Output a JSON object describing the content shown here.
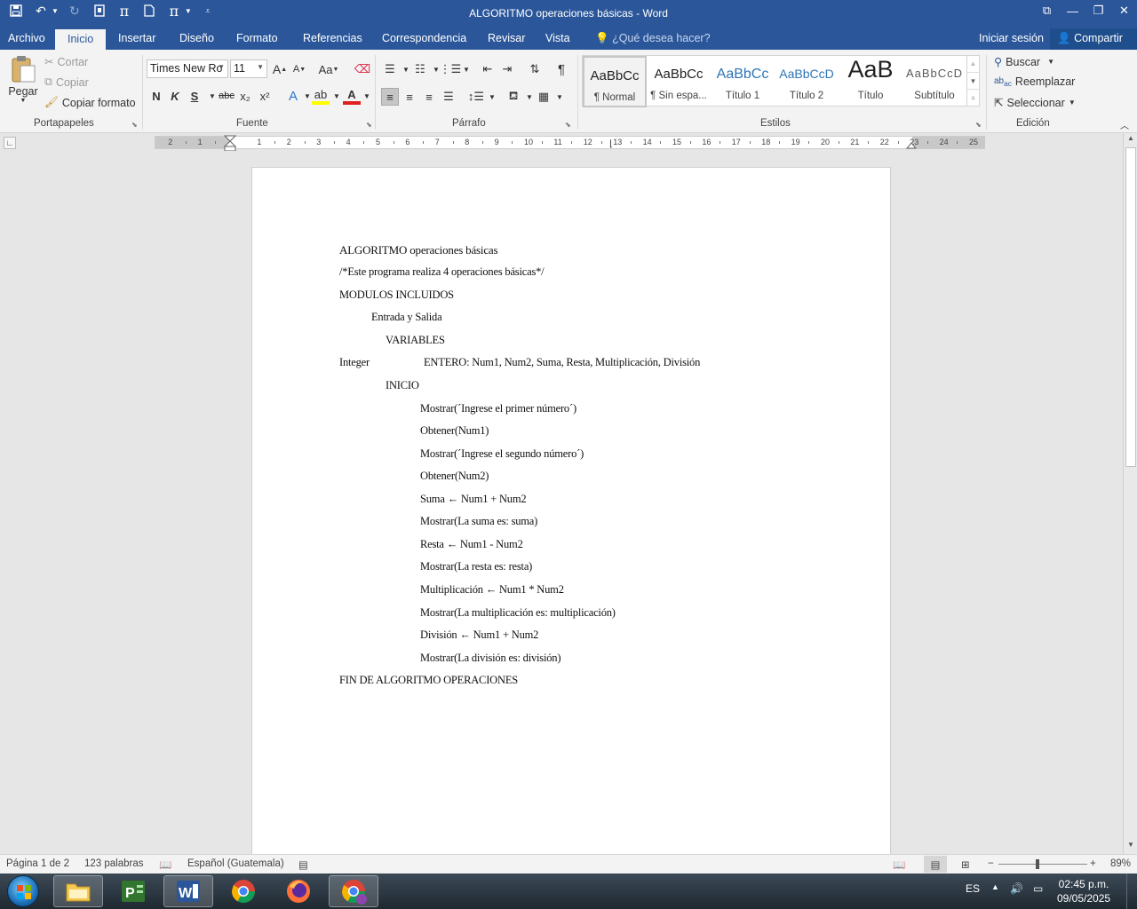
{
  "window": {
    "title": "ALGORITMO operaciones básicas - Word"
  },
  "tabs": {
    "archivo": "Archivo",
    "inicio": "Inicio",
    "insertar": "Insertar",
    "diseno": "Diseño",
    "formato": "Formato",
    "referencias": "Referencias",
    "correspondencia": "Correspondencia",
    "revisar": "Revisar",
    "vista": "Vista",
    "tellme": "¿Qué desea hacer?",
    "signin": "Iniciar sesión",
    "share": "Compartir"
  },
  "ribbon": {
    "clipboard": {
      "paste": "Pegar",
      "cut": "Cortar",
      "copy": "Copiar",
      "format_painter": "Copiar formato",
      "label": "Portapapeles"
    },
    "font": {
      "name": "Times New Ro",
      "size": "11",
      "label": "Fuente",
      "bold": "N",
      "italic": "K",
      "underline": "S",
      "strike": "abc",
      "subscript": "x₂",
      "superscript": "x²",
      "grow": "A",
      "shrink": "A",
      "case": "Aa",
      "effects": "A",
      "highlight": "ab",
      "color": "A"
    },
    "paragraph": {
      "label": "Párrafo"
    },
    "styles": {
      "label": "Estilos",
      "items": [
        {
          "sample": "AaBbCc",
          "name": "¶ Normal"
        },
        {
          "sample": "AaBbCc",
          "name": "¶ Sin espa..."
        },
        {
          "sample": "AaBbCc",
          "name": "Título 1"
        },
        {
          "sample": "AaBbCcD",
          "name": "Título 2"
        },
        {
          "sample": "AaB",
          "name": "Título"
        },
        {
          "sample": "AaBbCcD",
          "name": "Subtítulo"
        }
      ]
    },
    "editing": {
      "label": "Edición",
      "find": "Buscar",
      "replace": "Reemplazar",
      "select": "Seleccionar"
    }
  },
  "ruler": {
    "numbers": [
      "2",
      "1",
      "1",
      "2",
      "3",
      "4",
      "5",
      "6",
      "7",
      "8",
      "9",
      "10",
      "11",
      "12",
      "13",
      "14",
      "15",
      "16",
      "17",
      "18",
      "19",
      "20",
      "21",
      "22",
      "23",
      "24",
      "25"
    ]
  },
  "document": {
    "lines": [
      "ALGORITMO operaciones básicas",
      "/*Este programa realiza 4 operaciones básicas*/",
      "MODULOS INCLUIDOS",
      "Entrada y Salida",
      "VARIABLES",
      "Integer",
      "ENTERO: Num1, Num2, Suma, Resta, Multiplicación, División",
      "INICIO",
      "Mostrar(´Ingrese el primer número´)",
      "Obtener(Num1)",
      "Mostrar(´Ingrese el segundo número´)",
      "Obtener(Num2)",
      "Suma ← Num1 + Num2",
      "Mostrar(La suma es: suma)",
      "Resta ← Num1 - Num2",
      "Mostrar(La resta es: resta)",
      "Multiplicación ← Num1 * Num2",
      "Mostrar(La multiplicación es: multiplicación)",
      "División ← Num1 + Num2",
      "Mostrar(La división es: división)",
      "FIN DE ALGORITMO OPERACIONES"
    ]
  },
  "status": {
    "page": "Página 1 de 2",
    "words": "123 palabras",
    "language": "Español (Guatemala)",
    "zoom": "89%"
  },
  "taskbar": {
    "lang": "ES",
    "time": "02:45 p.m.",
    "date": "09/05/2025"
  },
  "colors": {
    "word_blue": "#2b579a",
    "ribbon_bg": "#f3f3f3"
  }
}
